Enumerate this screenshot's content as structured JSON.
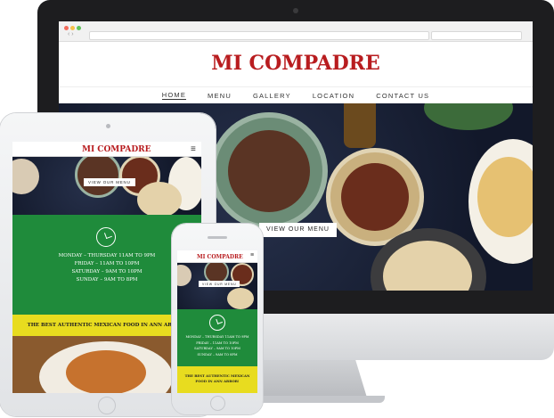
{
  "brand": {
    "name": "MI COMPADRE",
    "accent": "#b81c1f",
    "green": "#1f8b3b",
    "yellow": "#e8dc1f"
  },
  "desktop": {
    "nav": [
      "HOME",
      "MENU",
      "GALLERY",
      "LOCATION",
      "CONTACT US"
    ],
    "active_nav": "HOME",
    "hero_button": "VIEW OUR MENU"
  },
  "tablet": {
    "hero_button": "VIEW OUR MENU",
    "hours": [
      "MONDAY – THURSDAY 11AM TO 9PM",
      "FRIDAY – 11AM TO 10PM",
      "SATURDAY – 9AM TO 10PM",
      "SUNDAY – 9AM TO 8PM"
    ],
    "tagline": "THE BEST AUTHENTIC MEXICAN FOOD IN ANN ARBOR!"
  },
  "phone": {
    "hero_button": "VIEW OUR MENU",
    "hours": [
      "MONDAY – THURSDAY 11AM TO 9PM",
      "FRIDAY – 11AM TO 10PM",
      "SATURDAY – 9AM TO 10PM",
      "SUNDAY – 9AM TO 8PM"
    ],
    "tagline": "THE BEST AUTHENTIC MEXICAN FOOD IN ANN ARBOR!"
  },
  "icons": [
    "hamburger-menu-icon",
    "clock-icon",
    "webcam-icon",
    "home-button-icon"
  ]
}
